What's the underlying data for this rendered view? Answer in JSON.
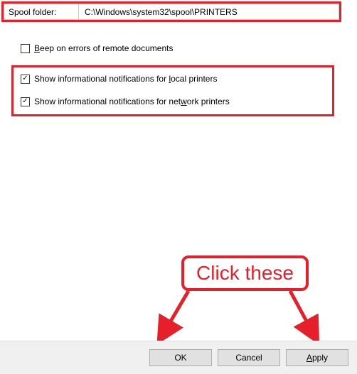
{
  "spool": {
    "label": "Spool folder:",
    "value": "C:\\Windows\\system32\\spool\\PRINTERS"
  },
  "checks": {
    "beep": {
      "checked": false,
      "pre": "",
      "hot": "B",
      "post": "eep on errors of remote documents"
    },
    "local": {
      "checked": true,
      "pre": "Show informational notifications for ",
      "hot": "l",
      "post": "ocal printers"
    },
    "network": {
      "checked": true,
      "pre": "Show informational notifications for net",
      "hot": "w",
      "post": "ork printers"
    }
  },
  "callout": {
    "text": "Click these"
  },
  "buttons": {
    "ok": "OK",
    "cancel": "Cancel",
    "apply_pre": "",
    "apply_hot": "A",
    "apply_post": "pply"
  }
}
